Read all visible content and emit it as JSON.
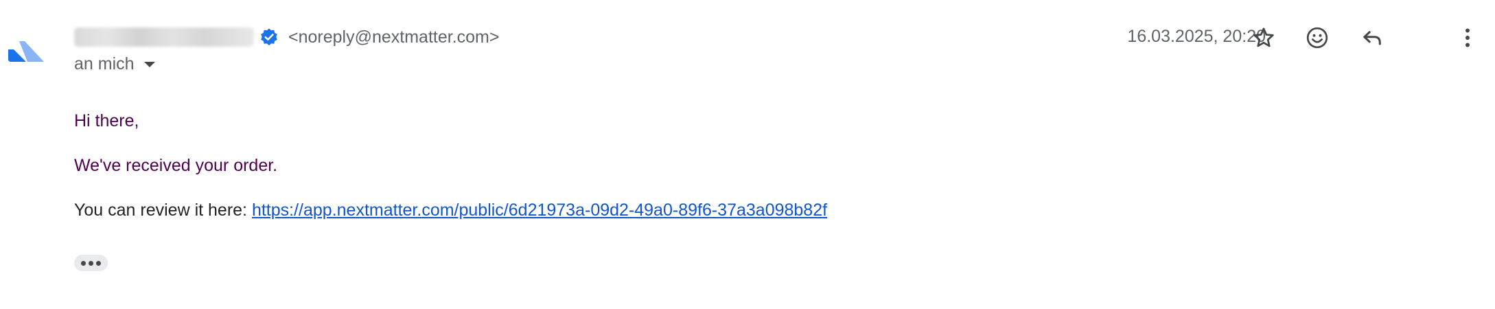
{
  "colors": {
    "purple_text": "#500050",
    "link": "#1155cc",
    "muted_text": "#5f6368",
    "verified_badge": "#1a73e8",
    "logo_light": "#8ab4f8",
    "logo_dark": "#1a73e8"
  },
  "sender": {
    "avatar_icon": "nextmatter-logo-icon",
    "verified_icon": "verified-badge-icon",
    "email": "<noreply@nextmatter.com>"
  },
  "recipient": {
    "label": "an mich",
    "dropdown_icon": "caret-down-icon"
  },
  "header": {
    "date": "16.03.2025, 20:20",
    "actions": [
      "star-icon",
      "emoji-icon",
      "reply-icon",
      "more-vert-icon"
    ]
  },
  "message": {
    "greeting": "Hi there,",
    "received": "We've received your order.",
    "review_prefix": "You can review it here: ",
    "review_link": "https://app.nextmatter.com/public/6d21973a-09d2-49a0-89f6-37a3a098b82f",
    "trimmed_icon": "show-trimmed-content-icon"
  }
}
